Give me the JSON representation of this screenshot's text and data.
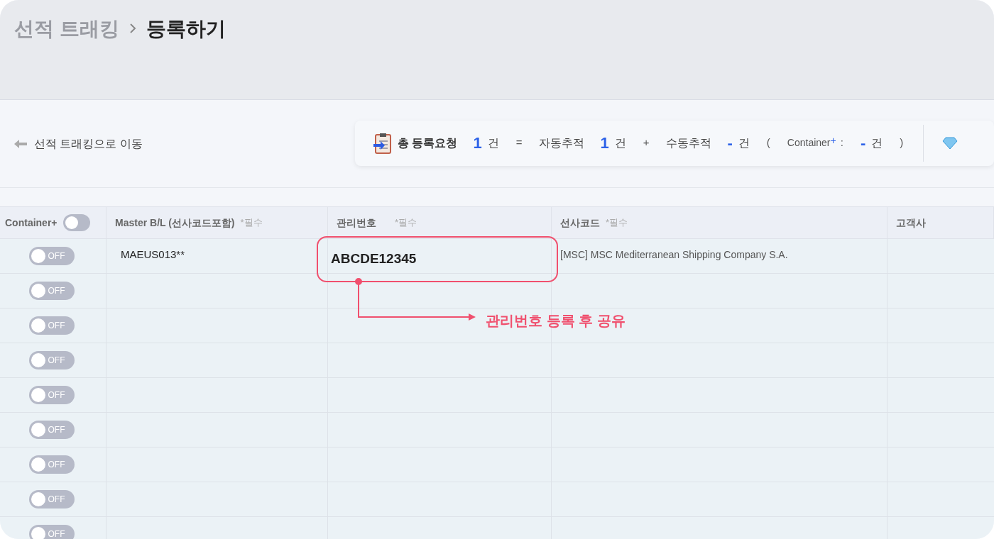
{
  "breadcrumb": [
    {
      "label": "선적 트래킹",
      "current": false
    },
    {
      "label": "등록하기",
      "current": true
    }
  ],
  "back_link": "선적 트래킹으로 이동",
  "summary": [
    {
      "kind": "title",
      "text": "총 등록요청"
    },
    {
      "kind": "count",
      "text": "1"
    },
    {
      "kind": "unit",
      "text": "건"
    },
    {
      "kind": "op",
      "text": "="
    },
    {
      "kind": "label",
      "text": "자동추적"
    },
    {
      "kind": "count",
      "text": "1"
    },
    {
      "kind": "unit",
      "text": "건"
    },
    {
      "kind": "op",
      "text": "+"
    },
    {
      "kind": "label",
      "text": "수동추적"
    },
    {
      "kind": "count",
      "text": "-"
    },
    {
      "kind": "unit",
      "text": "건"
    },
    {
      "kind": "op",
      "text": "("
    },
    {
      "kind": "small",
      "text": "Container"
    },
    {
      "kind": "sup",
      "text": "+"
    },
    {
      "kind": "op",
      "text": ":"
    },
    {
      "kind": "count",
      "text": "-"
    },
    {
      "kind": "unit",
      "text": "건"
    },
    {
      "kind": "op",
      "text": ")"
    }
  ],
  "table": {
    "columns": [
      {
        "label": "Container+",
        "toggle": {
          "on": false
        }
      },
      {
        "label": "Master B/L (선사코드포함)",
        "required": "*필수"
      },
      {
        "label": "관리번호",
        "required": "*필수"
      },
      {
        "label": "선사코드",
        "required": "*필수"
      },
      {
        "label": "고객사"
      }
    ],
    "rows": [
      {
        "container": {
          "on": false,
          "label": "OFF"
        },
        "mbl": "MAEUS013**",
        "mgmt_no": "ABCDE12345",
        "carrier": "[MSC] MSC Mediterranean Shipping Company S.A."
      },
      {
        "container": {
          "on": false,
          "label": "OFF"
        }
      },
      {
        "container": {
          "on": false,
          "label": "OFF"
        }
      },
      {
        "container": {
          "on": false,
          "label": "OFF"
        }
      },
      {
        "container": {
          "on": false,
          "label": "OFF"
        }
      },
      {
        "container": {
          "on": false,
          "label": "OFF"
        }
      },
      {
        "container": {
          "on": false,
          "label": "OFF"
        }
      },
      {
        "container": {
          "on": false,
          "label": "OFF"
        }
      },
      {
        "container": {
          "on": false,
          "label": "OFF"
        }
      }
    ]
  },
  "annotation": {
    "label": "관리번호 등록 후 공유"
  }
}
